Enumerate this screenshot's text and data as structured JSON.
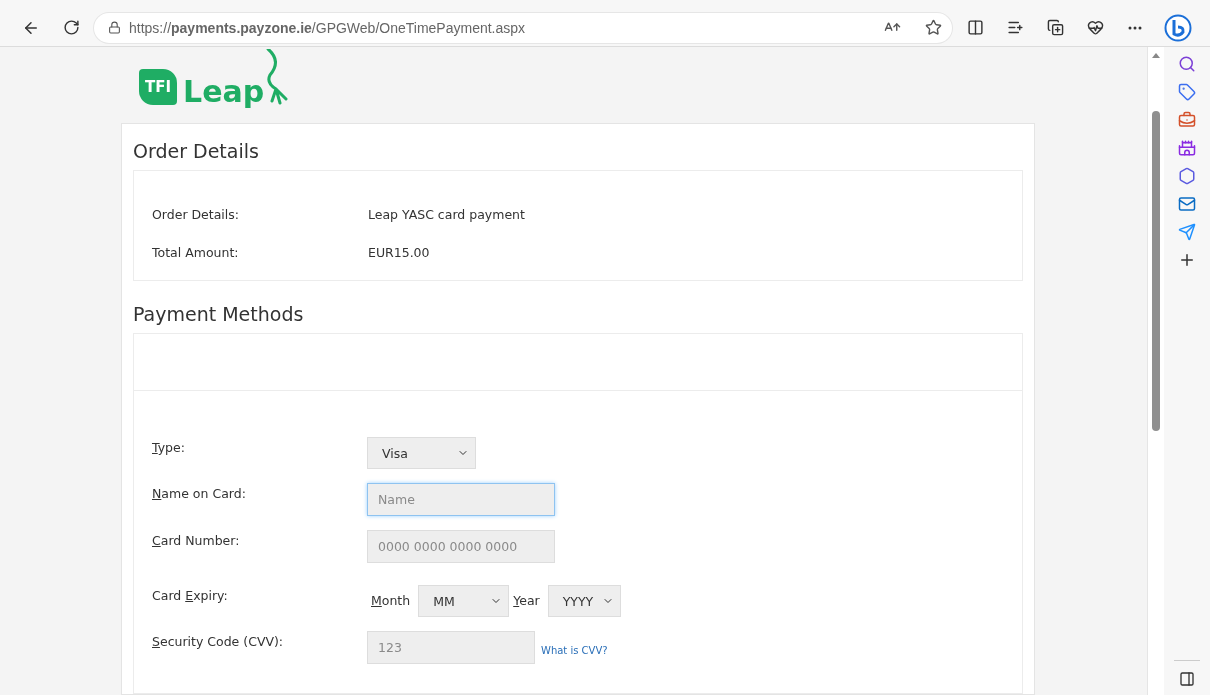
{
  "browser": {
    "url": "https://**payments.payzone.ie**/GPGWeb/OneTimePayment.aspx"
  },
  "logo": {
    "badge": "TFI",
    "word": "Leap"
  },
  "order": {
    "title": "Order Details",
    "rows": [
      {
        "label": "Order Details:",
        "value": "Leap YASC card payment"
      },
      {
        "label": "Total Amount:",
        "value": "EUR15.00"
      }
    ]
  },
  "payment": {
    "title": "Payment Methods",
    "fields": [
      {
        "kind": "select",
        "label": {
          "key": "T",
          "after": "ype:"
        },
        "value": "Visa"
      },
      {
        "kind": "input",
        "label": {
          "key": "N",
          "after": "ame on Card:"
        },
        "placeholder": "Name",
        "focused": true
      },
      {
        "kind": "input",
        "label": {
          "key": "C",
          "after": "ard Number:"
        },
        "placeholder": "0000 0000 0000 0000",
        "focused": false
      },
      {
        "kind": "expiry",
        "label": {
          "before": "Card ",
          "key": "E",
          "after": "xpiry:"
        },
        "month": {
          "label": {
            "key": "M",
            "after": "onth"
          },
          "value": "MM"
        },
        "year": {
          "label": {
            "key": "Y",
            "after": "ear"
          },
          "value": "YYYY"
        }
      },
      {
        "kind": "input",
        "label": {
          "key": "S",
          "after": "ecurity Code (CVV):"
        },
        "placeholder": "123",
        "focused": false,
        "link": "What is CVV?"
      }
    ]
  }
}
